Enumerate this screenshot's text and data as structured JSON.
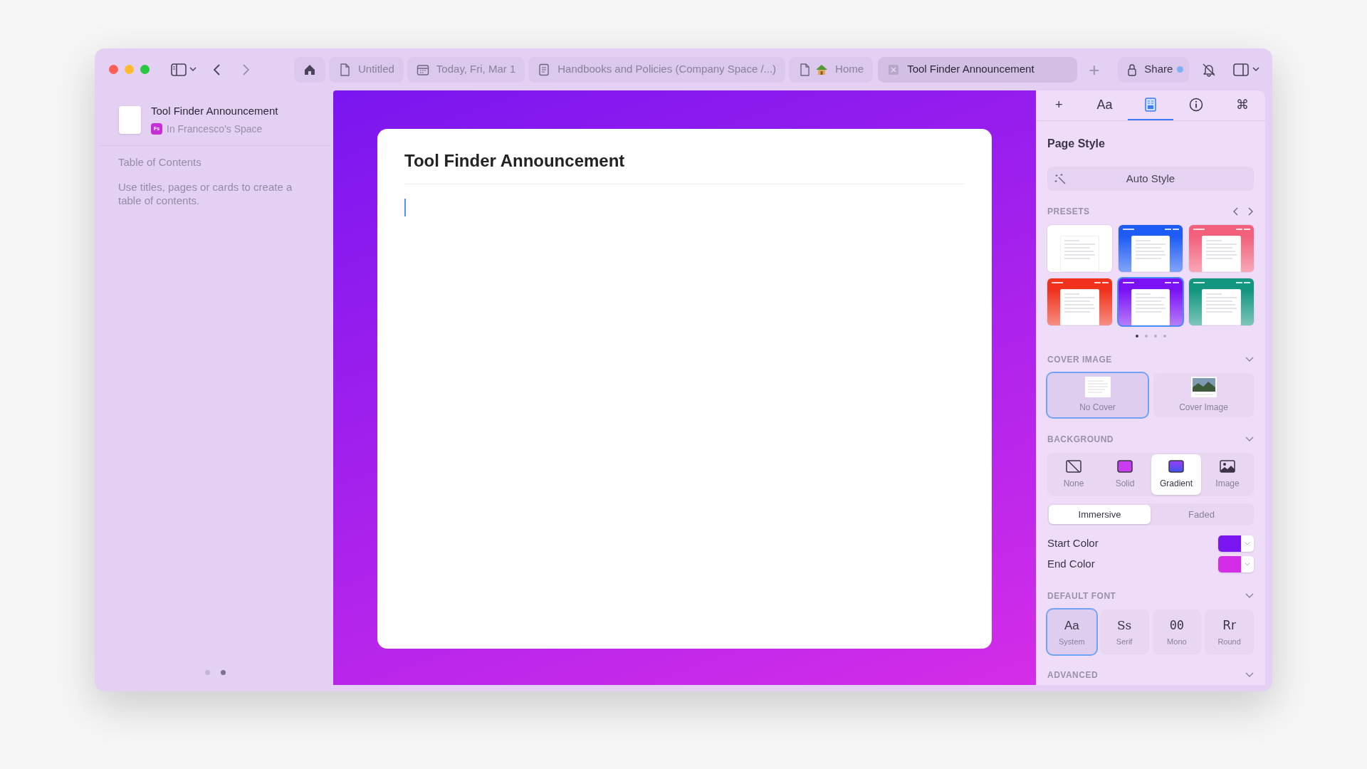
{
  "toolbar": {
    "tabs": [
      {
        "kind": "home",
        "selected": false
      },
      {
        "kind": "page",
        "label": "Untitled",
        "selected": false
      },
      {
        "kind": "calendar",
        "label": "Today, Fri, Mar 1",
        "selected": false
      },
      {
        "kind": "document",
        "label": "Handbooks and Policies (Company Space /...)",
        "selected": false
      },
      {
        "kind": "house-page",
        "label": "Home",
        "selected": false
      },
      {
        "kind": "box",
        "label": "Tool Finder Announcement",
        "selected": true
      }
    ],
    "new_tab": "+",
    "share": {
      "label": "Share",
      "notification": true
    }
  },
  "sidebar": {
    "doc_title": "Tool Finder Announcement",
    "space_badge": "Fs",
    "space": "In Francesco’s Space",
    "toc_heading": "Table of Contents",
    "toc_hint": "Use titles, pages or cards to create a table of contents.",
    "pages": [
      {
        "selected": false
      },
      {
        "selected": true
      }
    ]
  },
  "document": {
    "title": "Tool Finder Announcement"
  },
  "inspector": {
    "tabs": [
      {
        "kind": "text",
        "label": "+",
        "selected": false
      },
      {
        "kind": "text",
        "label": "Aa",
        "selected": false
      },
      {
        "kind": "style",
        "selected": true
      },
      {
        "kind": "info",
        "selected": false
      },
      {
        "kind": "text",
        "label": "⌘",
        "selected": false
      }
    ],
    "heading": "Page Style",
    "auto_style": "Auto Style",
    "presets_label": "PRESETS",
    "presets": [
      {
        "color": "#ffffff",
        "selected": false
      },
      {
        "color": "#1d5cf5",
        "selected": false
      },
      {
        "color": "#f2607c",
        "selected": false
      },
      {
        "color": "#f0321c",
        "selected": false
      },
      {
        "color": "#7a12f5",
        "selected": true
      },
      {
        "color": "#129680",
        "selected": false
      }
    ],
    "preset_pages": [
      {
        "selected": true
      },
      {
        "selected": false
      },
      {
        "selected": false
      },
      {
        "selected": false
      }
    ],
    "cover_label": "COVER IMAGE",
    "cover_options": [
      {
        "kind": "none",
        "label": "No Cover",
        "selected": true
      },
      {
        "kind": "image",
        "label": "Cover Image",
        "selected": false
      }
    ],
    "background_label": "BACKGROUND",
    "background_options": [
      {
        "kind": "none",
        "label": "None",
        "selected": false
      },
      {
        "kind": "solid",
        "label": "Solid",
        "selected": false
      },
      {
        "kind": "gradient",
        "label": "Gradient",
        "selected": true
      },
      {
        "kind": "image",
        "label": "Image",
        "selected": false
      }
    ],
    "modes": [
      {
        "label": "Immersive",
        "selected": true
      },
      {
        "label": "Faded",
        "selected": false
      }
    ],
    "start_color": {
      "label": "Start Color",
      "color": "#7a16f0"
    },
    "end_color": {
      "label": "End Color",
      "color": "#d42de8"
    },
    "font_label": "DEFAULT FONT",
    "fonts": [
      {
        "kind": "system",
        "sample": "Aa",
        "label": "System",
        "selected": true
      },
      {
        "kind": "serif",
        "sample": "Ss",
        "label": "Serif",
        "selected": false
      },
      {
        "kind": "mono",
        "sample": "00",
        "label": "Mono",
        "selected": false
      },
      {
        "kind": "round",
        "sample": "Rr",
        "label": "Round",
        "selected": false
      }
    ],
    "advanced_label": "ADVANCED"
  }
}
